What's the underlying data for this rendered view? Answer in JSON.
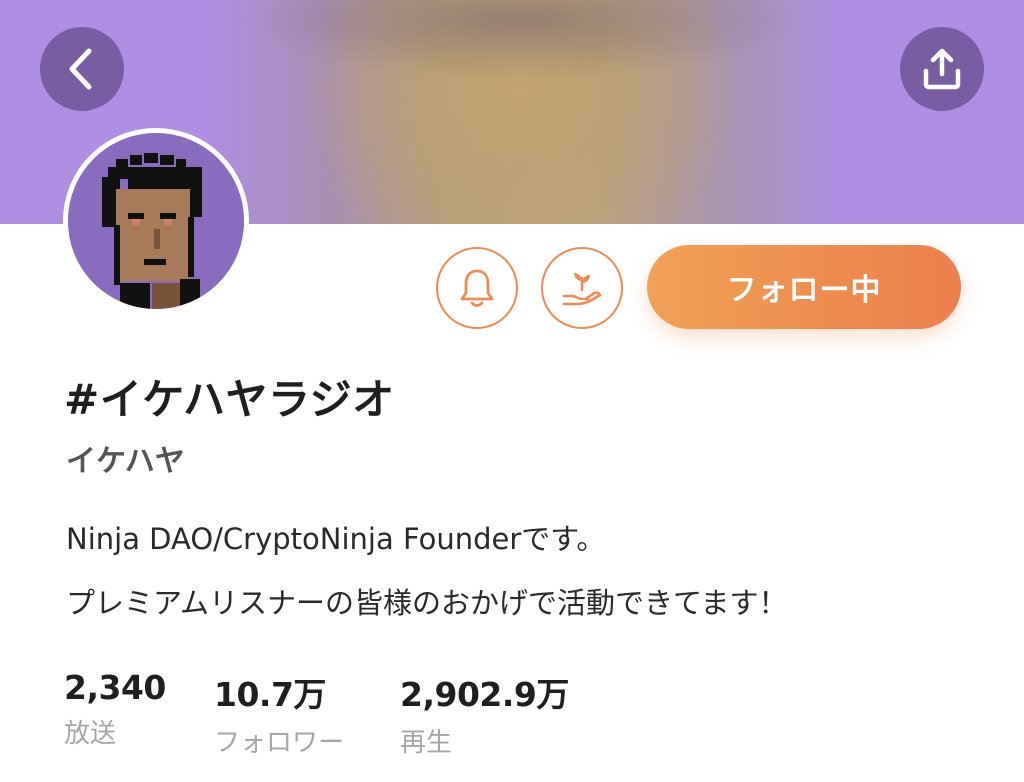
{
  "header": {
    "back_icon": "chevron-left-icon",
    "share_icon": "share-icon"
  },
  "profile": {
    "title": "#イケハヤラジオ",
    "author": "イケハヤ",
    "bio_line1": "Ninja DAO/CryptoNinja Founderです。",
    "bio_line2": "プレミアムリスナーの皆様のおかげで活動できてます！"
  },
  "actions": {
    "bell_icon": "bell-icon",
    "support_icon": "sprout-hand-icon",
    "follow_label": "フォロー中"
  },
  "stats": {
    "broadcasts": {
      "value": "2,340",
      "label": "放送"
    },
    "followers": {
      "value": "10.7万",
      "label": "フォロワー"
    },
    "plays": {
      "value": "2,902.9万",
      "label": "再生"
    }
  },
  "colors": {
    "banner_purple": "#b08fe2",
    "accent_orange": "#ee8d50",
    "avatar_bg": "#8a6cbe"
  }
}
